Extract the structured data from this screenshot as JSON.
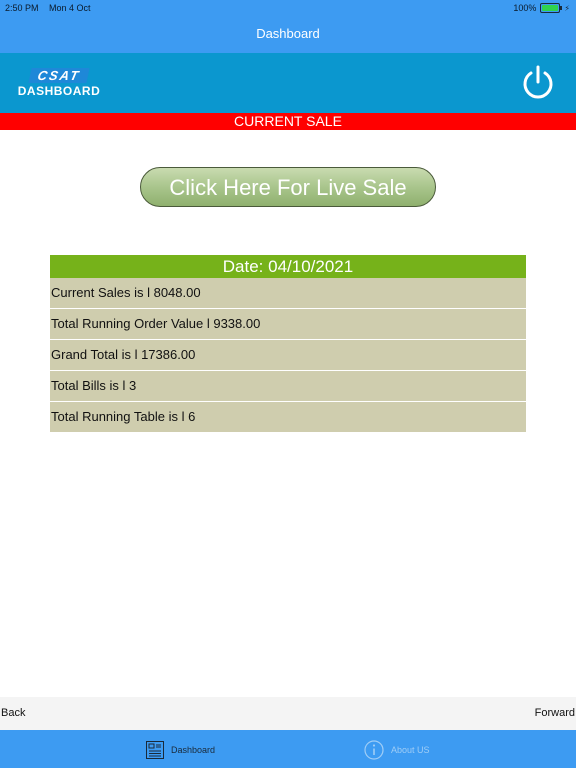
{
  "status_bar": {
    "time": "2:50 PM",
    "date": "Mon 4 Oct",
    "battery": "100%",
    "battery_level": 1.0
  },
  "nav": {
    "title": "Dashboard"
  },
  "header": {
    "logo_top": "CSAT",
    "logo_bottom": "DASHBOARD",
    "power_icon": "power-icon"
  },
  "banner": {
    "label": "CURRENT SALE"
  },
  "live_button": {
    "label": "Click Here For Live Sale"
  },
  "summary": {
    "date_label": "Date: 04/10/2021",
    "rows": [
      {
        "label": "Current Sales is l 8048.00"
      },
      {
        "label": "Total Running Order Value l 9338.00"
      },
      {
        "label": "Grand Total is l 17386.00"
      },
      {
        "label": "Total Bills is l 3"
      },
      {
        "label": "Total Running Table is l 6"
      }
    ]
  },
  "browser_nav": {
    "back": "Back",
    "forward": "Forward"
  },
  "tabs": [
    {
      "label": "Dashboard",
      "icon": "dashboard-icon",
      "active": true
    },
    {
      "label": "About US",
      "icon": "info-icon",
      "active": false
    }
  ],
  "colors": {
    "status_nav": "#3d9bf2",
    "header": "#0b97cf",
    "banner": "#ff0000",
    "date_row": "#76b21a",
    "table_row": "#cfcdae"
  }
}
